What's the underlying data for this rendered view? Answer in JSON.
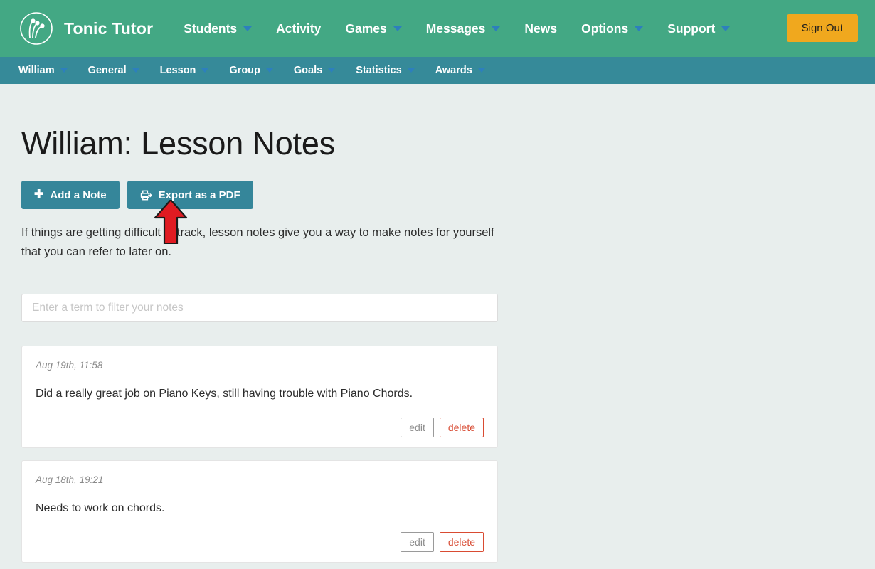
{
  "header": {
    "brand_name": "Tonic Tutor",
    "logo_icon": "tonic-tutor-logo-icon",
    "signout_label": "Sign Out",
    "accent_green": "#43a884",
    "accent_orange": "#f0a81e",
    "nav": [
      {
        "label": "Students",
        "has_caret": true
      },
      {
        "label": "Activity",
        "has_caret": false
      },
      {
        "label": "Games",
        "has_caret": true
      },
      {
        "label": "Messages",
        "has_caret": true
      },
      {
        "label": "News",
        "has_caret": false
      },
      {
        "label": "Options",
        "has_caret": true
      },
      {
        "label": "Support",
        "has_caret": true
      }
    ]
  },
  "subnav": {
    "bar_color": "#368a99",
    "items": [
      {
        "label": "William",
        "has_caret": true
      },
      {
        "label": "General",
        "has_caret": true
      },
      {
        "label": "Lesson",
        "has_caret": true
      },
      {
        "label": "Group",
        "has_caret": true
      },
      {
        "label": "Goals",
        "has_caret": true
      },
      {
        "label": "Statistics",
        "has_caret": true
      },
      {
        "label": "Awards",
        "has_caret": true
      }
    ]
  },
  "main": {
    "page_title": "William: Lesson Notes",
    "add_note_label": "Add a Note",
    "add_note_icon": "plus-icon",
    "export_pdf_label": "Export as a PDF",
    "export_pdf_icon": "printer-export-icon",
    "button_color": "#35869a",
    "description": "If things are getting difficult to track, lesson notes give you a way to make notes for yourself that you can refer to later on.",
    "filter_placeholder": "Enter a term to filter your notes",
    "filter_value": "",
    "edit_label": "edit",
    "delete_label": "delete",
    "delete_color": "#d9513a",
    "notes": [
      {
        "date": "Aug 19th, 11:58",
        "text": "Did a really great job on Piano Keys, still having trouble with Piano Chords."
      },
      {
        "date": "Aug 18th, 19:21",
        "text": "Needs to work on chords."
      }
    ]
  },
  "annotation": {
    "arrow_icon": "red-up-arrow-annotation",
    "color": "#e01b22"
  }
}
